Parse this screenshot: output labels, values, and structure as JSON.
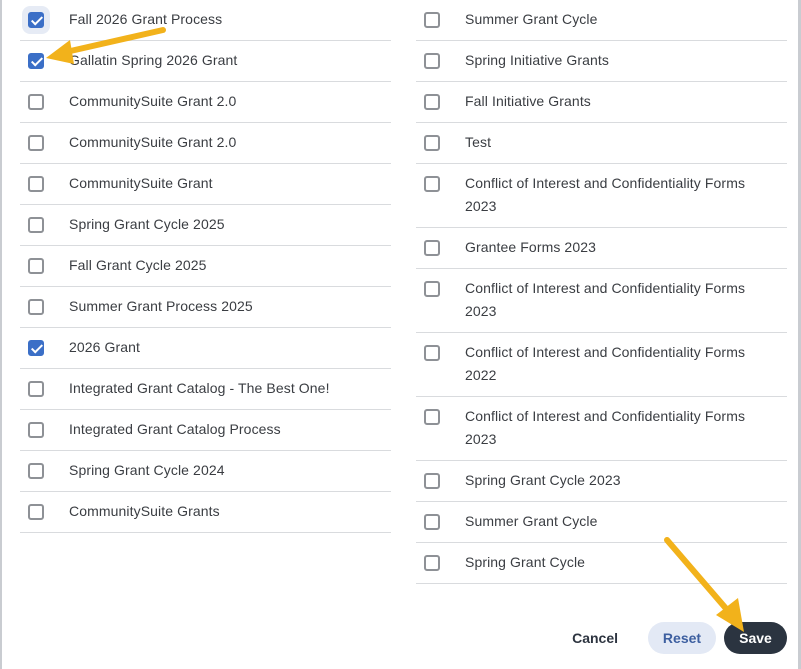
{
  "left_column": [
    {
      "label": "Fall 2026 Grant Process",
      "checked": true
    },
    {
      "label": "Gallatin Spring 2026 Grant",
      "checked": true
    },
    {
      "label": "CommunitySuite Grant 2.0",
      "checked": false
    },
    {
      "label": "CommunitySuite Grant 2.0",
      "checked": false
    },
    {
      "label": "CommunitySuite Grant",
      "checked": false
    },
    {
      "label": "Spring Grant Cycle 2025",
      "checked": false
    },
    {
      "label": "Fall Grant Cycle 2025",
      "checked": false
    },
    {
      "label": "Summer Grant Process 2025",
      "checked": false
    },
    {
      "label": "2026 Grant",
      "checked": true
    },
    {
      "label": "Integrated Grant Catalog - The Best One!",
      "checked": false
    },
    {
      "label": "Integrated Grant Catalog Process",
      "checked": false
    },
    {
      "label": "Spring Grant Cycle 2024",
      "checked": false
    },
    {
      "label": "CommunitySuite Grants",
      "checked": false
    }
  ],
  "right_column": [
    {
      "label": "Summer Grant Cycle",
      "checked": false
    },
    {
      "label": "Spring Initiative Grants",
      "checked": false
    },
    {
      "label": "Fall Initiative Grants",
      "checked": false
    },
    {
      "label": "Test",
      "checked": false
    },
    {
      "label": "Conflict of Interest and Confidentiality Forms 2023",
      "checked": false
    },
    {
      "label": "Grantee Forms 2023",
      "checked": false
    },
    {
      "label": "Conflict of Interest and Confidentiality Forms 2023",
      "checked": false
    },
    {
      "label": "Conflict of Interest and Confidentiality Forms 2022",
      "checked": false
    },
    {
      "label": "Conflict of Interest and Confidentiality Forms 2023",
      "checked": false
    },
    {
      "label": "Spring Grant Cycle 2023",
      "checked": false
    },
    {
      "label": "Summer Grant Cycle",
      "checked": false
    },
    {
      "label": "Spring Grant Cycle",
      "checked": false
    }
  ],
  "actions": {
    "cancel_label": "Cancel",
    "reset_label": "Reset",
    "save_label": "Save"
  },
  "colors": {
    "checkbox_checked": "#3b6fc7",
    "save_button_bg": "#2b3440",
    "reset_button_bg": "#e3e9f5",
    "annotation_arrow": "#f2b21b"
  },
  "annotation_icons": [
    "arrow-annotation-icon",
    "arrow-annotation-icon"
  ]
}
